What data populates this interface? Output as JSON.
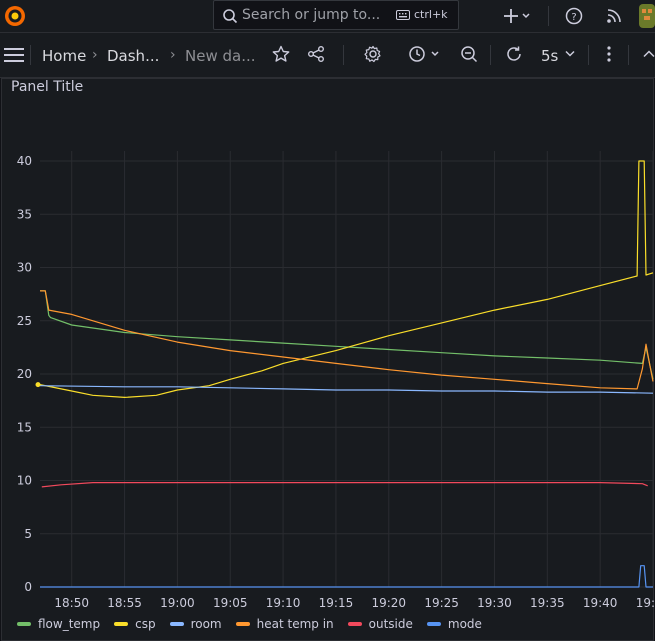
{
  "topbar": {
    "search_placeholder": "Search or jump to...",
    "shortcut": "ctrl+k"
  },
  "navbar": {
    "breadcrumbs": [
      "Home",
      "Dash...",
      "New da..."
    ],
    "refresh_interval": "5s"
  },
  "panel": {
    "title": "Panel Title"
  },
  "colors": {
    "flow_temp": "#73bf69",
    "csp": "#fade2a",
    "room": "#8ab8ff",
    "heat_temp_in": "#ff9830",
    "outside": "#f2495c",
    "mode": "#5794f2"
  },
  "chart_data": {
    "type": "line",
    "title": "Panel Title",
    "y_ticks": [
      "0",
      "5",
      "10",
      "15",
      "20",
      "25",
      "30",
      "35",
      "40"
    ],
    "x_ticks": [
      "18:50",
      "18:55",
      "19:00",
      "19:05",
      "19:10",
      "19:15",
      "19:20",
      "19:25",
      "19:30",
      "19:35",
      "19:40",
      "19:45"
    ],
    "ylim": [
      0,
      40
    ],
    "xlim": [
      "18:47",
      "19:45"
    ],
    "grid": true,
    "legend_position": "bottom",
    "series": [
      {
        "name": "flow_temp",
        "color": "#73bf69",
        "points": [
          [
            "18:47",
            27.8
          ],
          [
            "18:47:30",
            27.8
          ],
          [
            "18:47:50",
            25.5
          ],
          [
            "18:48",
            25.3
          ],
          [
            "18:50",
            24.6
          ],
          [
            "18:55",
            23.9
          ],
          [
            "19:00",
            23.5
          ],
          [
            "19:05",
            23.2
          ],
          [
            "19:10",
            22.9
          ],
          [
            "19:15",
            22.6
          ],
          [
            "19:20",
            22.3
          ],
          [
            "19:25",
            22.0
          ],
          [
            "19:30",
            21.7
          ],
          [
            "19:35",
            21.5
          ],
          [
            "19:40",
            21.3
          ],
          [
            "19:44",
            21.0
          ],
          [
            "19:44:20",
            22.5
          ],
          [
            "19:44:40",
            21.0
          ],
          [
            "19:45",
            19.5
          ]
        ]
      },
      {
        "name": "csp",
        "color": "#fade2a",
        "points": [
          [
            "18:47",
            19.0
          ],
          [
            "18:50",
            18.4
          ],
          [
            "18:52",
            18.0
          ],
          [
            "18:55",
            17.8
          ],
          [
            "18:58",
            18.0
          ],
          [
            "19:00",
            18.5
          ],
          [
            "19:03",
            18.9
          ],
          [
            "19:05",
            19.5
          ],
          [
            "19:08",
            20.3
          ],
          [
            "19:10",
            21.0
          ],
          [
            "19:15",
            22.2
          ],
          [
            "19:20",
            23.6
          ],
          [
            "19:25",
            24.8
          ],
          [
            "19:30",
            26.0
          ],
          [
            "19:35",
            27.0
          ],
          [
            "19:40",
            28.3
          ],
          [
            "19:43:30",
            29.2
          ],
          [
            "19:43:40",
            40.0
          ],
          [
            "19:44:10",
            40.0
          ],
          [
            "19:44:20",
            29.3
          ],
          [
            "19:45",
            29.5
          ]
        ]
      },
      {
        "name": "room",
        "color": "#8ab8ff",
        "points": [
          [
            "18:47",
            18.9
          ],
          [
            "18:55",
            18.8
          ],
          [
            "19:00",
            18.8
          ],
          [
            "19:05",
            18.7
          ],
          [
            "19:10",
            18.6
          ],
          [
            "19:15",
            18.5
          ],
          [
            "19:20",
            18.5
          ],
          [
            "19:25",
            18.4
          ],
          [
            "19:30",
            18.4
          ],
          [
            "19:35",
            18.3
          ],
          [
            "19:40",
            18.3
          ],
          [
            "19:45",
            18.2
          ]
        ]
      },
      {
        "name": "heat temp in",
        "color": "#ff9830",
        "points": [
          [
            "18:47",
            27.8
          ],
          [
            "18:47:30",
            27.8
          ],
          [
            "18:47:50",
            26.0
          ],
          [
            "18:50",
            25.6
          ],
          [
            "18:55",
            24.1
          ],
          [
            "19:00",
            23.0
          ],
          [
            "19:05",
            22.2
          ],
          [
            "19:10",
            21.6
          ],
          [
            "19:15",
            21.0
          ],
          [
            "19:20",
            20.4
          ],
          [
            "19:25",
            19.9
          ],
          [
            "19:30",
            19.5
          ],
          [
            "19:35",
            19.1
          ],
          [
            "19:40",
            18.7
          ],
          [
            "19:43:30",
            18.6
          ],
          [
            "19:44",
            20.5
          ],
          [
            "19:44:20",
            22.8
          ],
          [
            "19:44:40",
            21.0
          ],
          [
            "19:45",
            19.3
          ]
        ]
      },
      {
        "name": "outside",
        "color": "#f2495c",
        "points": [
          [
            "18:47:10",
            9.4
          ],
          [
            "18:49",
            9.6
          ],
          [
            "18:52",
            9.8
          ],
          [
            "18:55",
            9.8
          ],
          [
            "19:00",
            9.8
          ],
          [
            "19:10",
            9.8
          ],
          [
            "19:20",
            9.8
          ],
          [
            "19:30",
            9.8
          ],
          [
            "19:40",
            9.8
          ],
          [
            "19:44",
            9.7
          ],
          [
            "19:44:30",
            9.5
          ]
        ]
      },
      {
        "name": "mode",
        "color": "#5794f2",
        "points": [
          [
            "18:47",
            0
          ],
          [
            "19:43:40",
            0
          ],
          [
            "19:43:50",
            2.0
          ],
          [
            "19:44:10",
            2.0
          ],
          [
            "19:44:20",
            0
          ],
          [
            "19:45",
            0
          ]
        ]
      }
    ]
  }
}
